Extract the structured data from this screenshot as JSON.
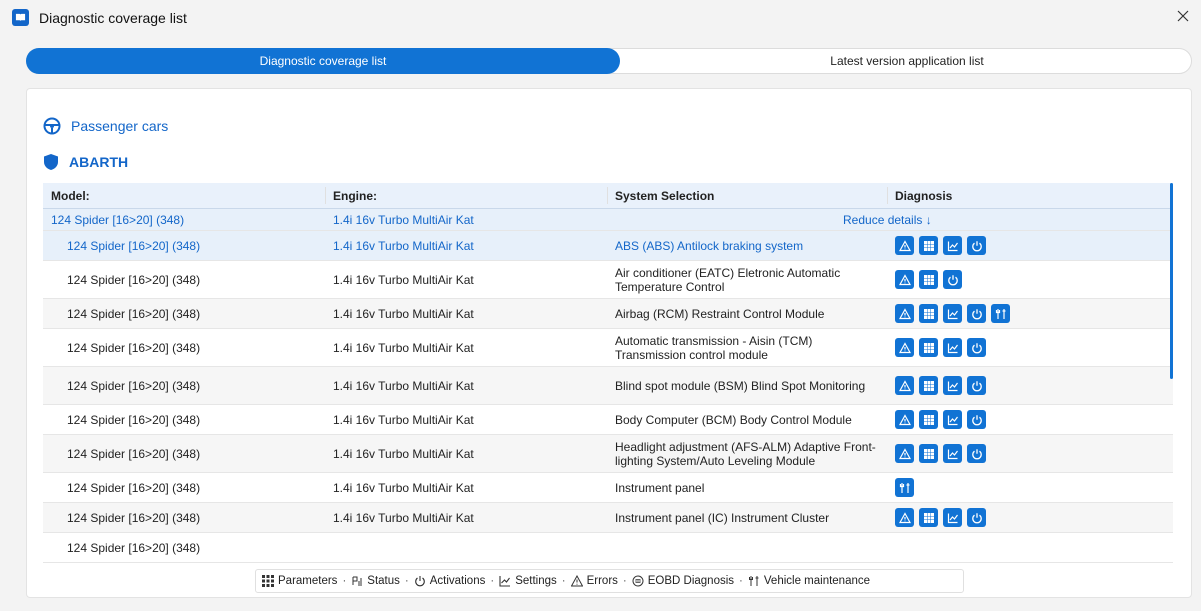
{
  "window": {
    "title": "Diagnostic coverage list"
  },
  "tabs": [
    {
      "label": "Diagnostic coverage list"
    },
    {
      "label": "Latest version application list"
    }
  ],
  "category": {
    "label": "Passenger cars"
  },
  "brand": {
    "label": "ABARTH"
  },
  "table": {
    "headers": {
      "model": "Model:",
      "engine": "Engine:",
      "system": "System Selection",
      "diagnosis": "Diagnosis"
    },
    "group": {
      "model": "124 Spider [16>20] (348)",
      "engine": "1.4i 16v Turbo MultiAir Kat",
      "reduce": "Reduce details ↓"
    },
    "rows": [
      {
        "model": "124 Spider [16>20] (348)",
        "engine": "1.4i 16v Turbo MultiAir Kat",
        "system": "ABS (ABS) Antilock braking system"
      },
      {
        "model": "124 Spider [16>20] (348)",
        "engine": "1.4i 16v Turbo MultiAir Kat",
        "system": "Air conditioner (EATC) Eletronic Automatic Temperature Control"
      },
      {
        "model": "124 Spider [16>20] (348)",
        "engine": "1.4i 16v Turbo MultiAir Kat",
        "system": "Airbag (RCM) Restraint Control Module"
      },
      {
        "model": "124 Spider [16>20] (348)",
        "engine": "1.4i 16v Turbo MultiAir Kat",
        "system": "Automatic transmission - Aisin (TCM) Transmission control module"
      },
      {
        "model": "124 Spider [16>20] (348)",
        "engine": "1.4i 16v Turbo MultiAir Kat",
        "system": "Blind spot module (BSM) Blind Spot Monitoring"
      },
      {
        "model": "124 Spider [16>20] (348)",
        "engine": "1.4i 16v Turbo MultiAir Kat",
        "system": "Body Computer (BCM) Body Control Module"
      },
      {
        "model": "124 Spider [16>20] (348)",
        "engine": "1.4i 16v Turbo MultiAir Kat",
        "system": "Headlight adjustment (AFS-ALM) Adaptive Front-lighting System/Auto Leveling Module"
      },
      {
        "model": "124 Spider [16>20] (348)",
        "engine": "1.4i 16v Turbo MultiAir Kat",
        "system": "Instrument panel"
      },
      {
        "model": "124 Spider [16>20] (348)",
        "engine": "1.4i 16v Turbo MultiAir Kat",
        "system": "Instrument panel (IC) Instrument Cluster"
      },
      {
        "model": "124 Spider [16>20] (348)",
        "engine": "",
        "system": ""
      }
    ]
  },
  "bottombar": {
    "parameters": "Parameters",
    "status": "Status",
    "activations": "Activations",
    "settings": "Settings",
    "errors": "Errors",
    "eobd": "EOBD Diagnosis",
    "maintenance": "Vehicle maintenance"
  },
  "colors": {
    "accent": "#1173d4",
    "link": "#1366c9"
  }
}
